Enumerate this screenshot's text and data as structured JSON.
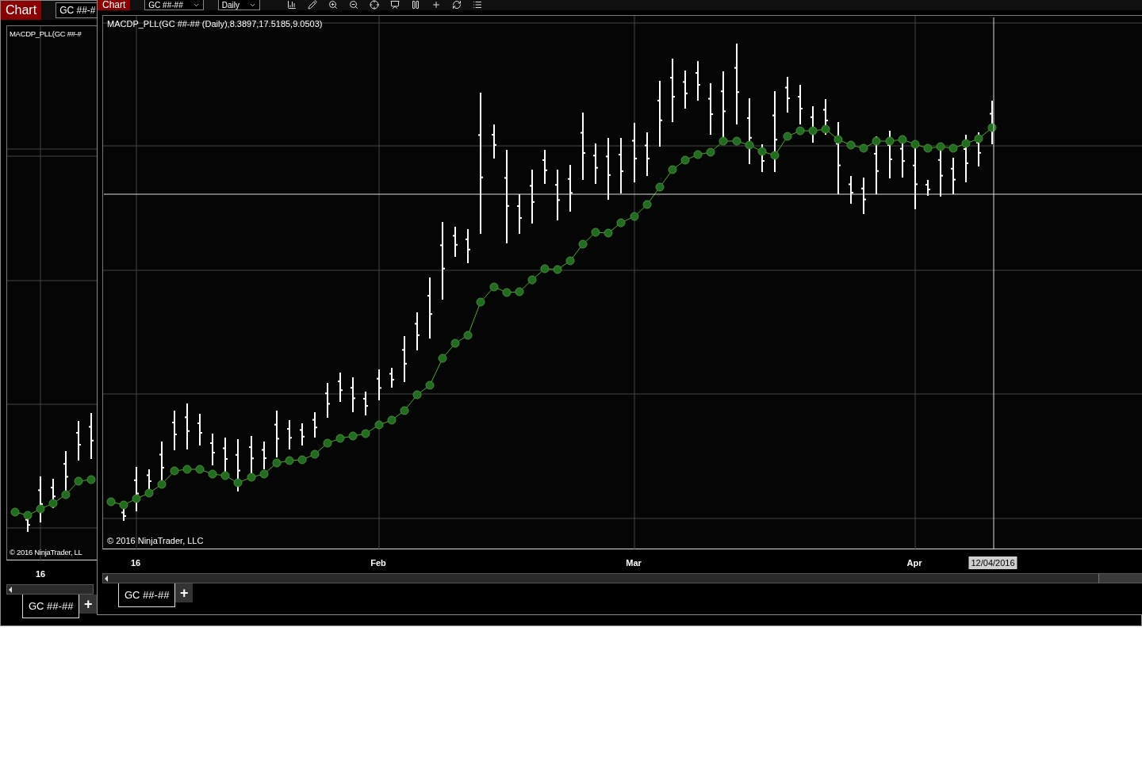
{
  "back_window": {
    "title": "Chart",
    "instrument": "GC ##-#",
    "indicator_label": "MACDP_PLL(GC ##-#",
    "copyright": "© 2016 NinjaTrader, LL",
    "x_axis": [
      "16"
    ],
    "tabs": [
      {
        "label": "GC ##-##",
        "selected": true
      }
    ],
    "add_tab": "+"
  },
  "front_window": {
    "title": "Chart",
    "instrument": "GC ##-##",
    "interval": "Daily",
    "indicator_label": "MACDP_PLL(GC ##-## (Daily),8.3897,17.5185,9.0503)",
    "copyright": "© 2016 NinjaTrader, LLC",
    "x_axis": [
      "16",
      "Feb",
      "Mar",
      "Apr"
    ],
    "crosshair_date": "12/04/2016",
    "tabs": [
      {
        "label": "GC ##-##",
        "selected": true
      }
    ],
    "add_tab": "+"
  }
}
